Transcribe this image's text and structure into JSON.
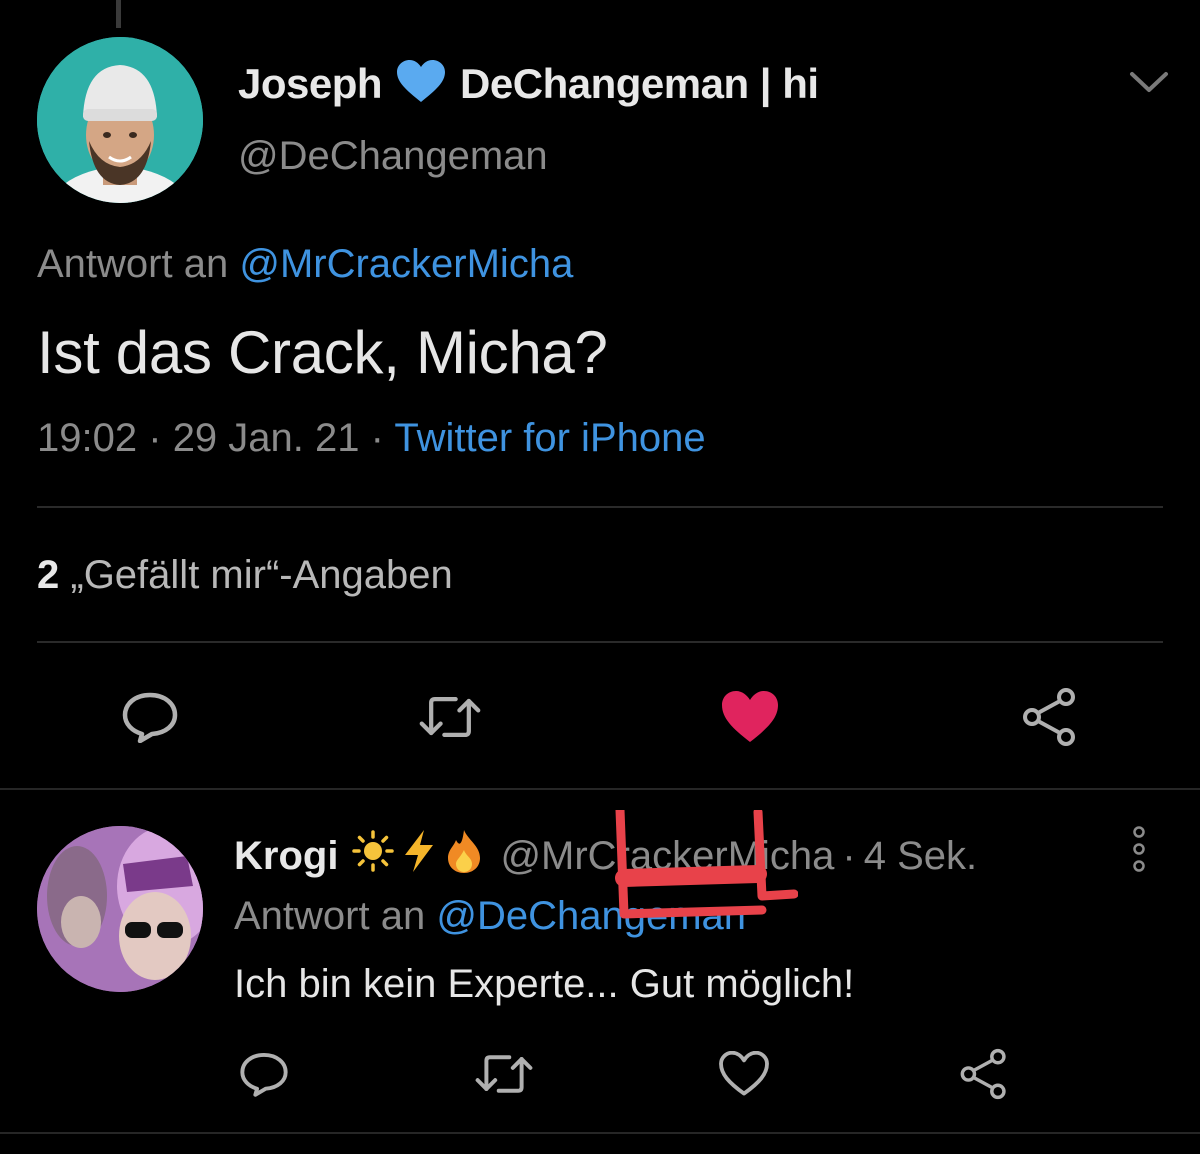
{
  "main_tweet": {
    "display_name_first": "Joseph",
    "display_name_rest": "DeChangeman | hi",
    "name_emoji_icon": "blue-heart-icon",
    "handle": "@DeChangeman",
    "reply_prefix": "Antwort an",
    "reply_to": "@MrCrackerMicha",
    "text": "Ist das Crack, Micha?",
    "time": "19:02",
    "date": "29 Jan. 21",
    "source": "Twitter for iPhone",
    "separator": "·",
    "likes_count": "2",
    "likes_label": "„Gefällt mir“-Angaben",
    "liked": true
  },
  "reply_tweet": {
    "display_name": "Krogi",
    "name_emoji_icons": [
      "sun-icon",
      "lightning-icon",
      "fire-icon"
    ],
    "handle": "@MrCrackerMicha",
    "time_ago": "4 Sek.",
    "separator": "·",
    "reply_prefix": "Antwort an",
    "reply_to": "@DeChangeman",
    "text": "Ich bin kein Experte... Gut möglich!",
    "liked": false
  },
  "colors": {
    "background": "#000000",
    "link": "#3f93e0",
    "muted_text": "#8b8b8b",
    "like_red": "#e0245e",
    "annotation_red": "#e8424a"
  }
}
